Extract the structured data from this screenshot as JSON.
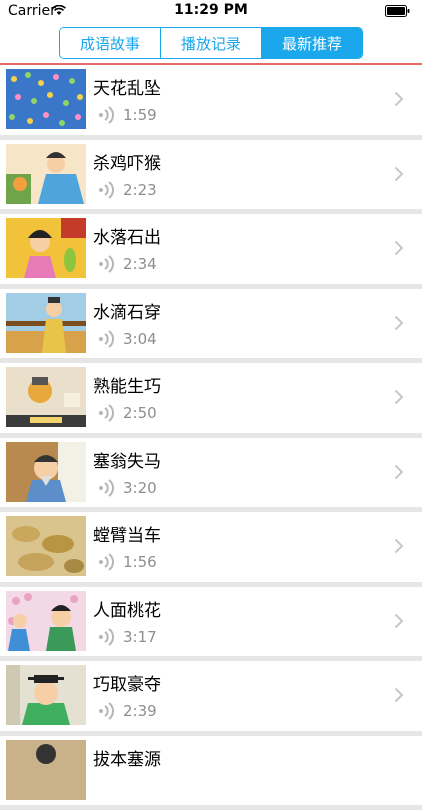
{
  "status_bar": {
    "carrier": "Carrier",
    "time": "11:29 PM"
  },
  "tabs": [
    {
      "label": "成语故事",
      "active": false
    },
    {
      "label": "播放记录",
      "active": false
    },
    {
      "label": "最新推荐",
      "active": true
    }
  ],
  "colors": {
    "accent": "#1aa7ec",
    "divider": "#e66a6a"
  },
  "stories": [
    {
      "title": "天花乱坠",
      "duration": "1:59",
      "thumb": "blue-flowers"
    },
    {
      "title": "杀鸡吓猴",
      "duration": "2:23",
      "thumb": "man-blue-robe"
    },
    {
      "title": "水落石出",
      "duration": "2:34",
      "thumb": "woman-pink"
    },
    {
      "title": "水滴石穿",
      "duration": "3:04",
      "thumb": "scholar-yellow"
    },
    {
      "title": "熟能生巧",
      "duration": "2:50",
      "thumb": "oil-seller"
    },
    {
      "title": "塞翁失马",
      "duration": "3:20",
      "thumb": "old-man"
    },
    {
      "title": "螳臂当车",
      "duration": "1:56",
      "thumb": "mantis-leaves"
    },
    {
      "title": "人面桃花",
      "duration": "3:17",
      "thumb": "peach-blossom"
    },
    {
      "title": "巧取豪夺",
      "duration": "2:39",
      "thumb": "official-green"
    },
    {
      "title": "拔本塞源",
      "duration": "",
      "thumb": "partial"
    }
  ]
}
